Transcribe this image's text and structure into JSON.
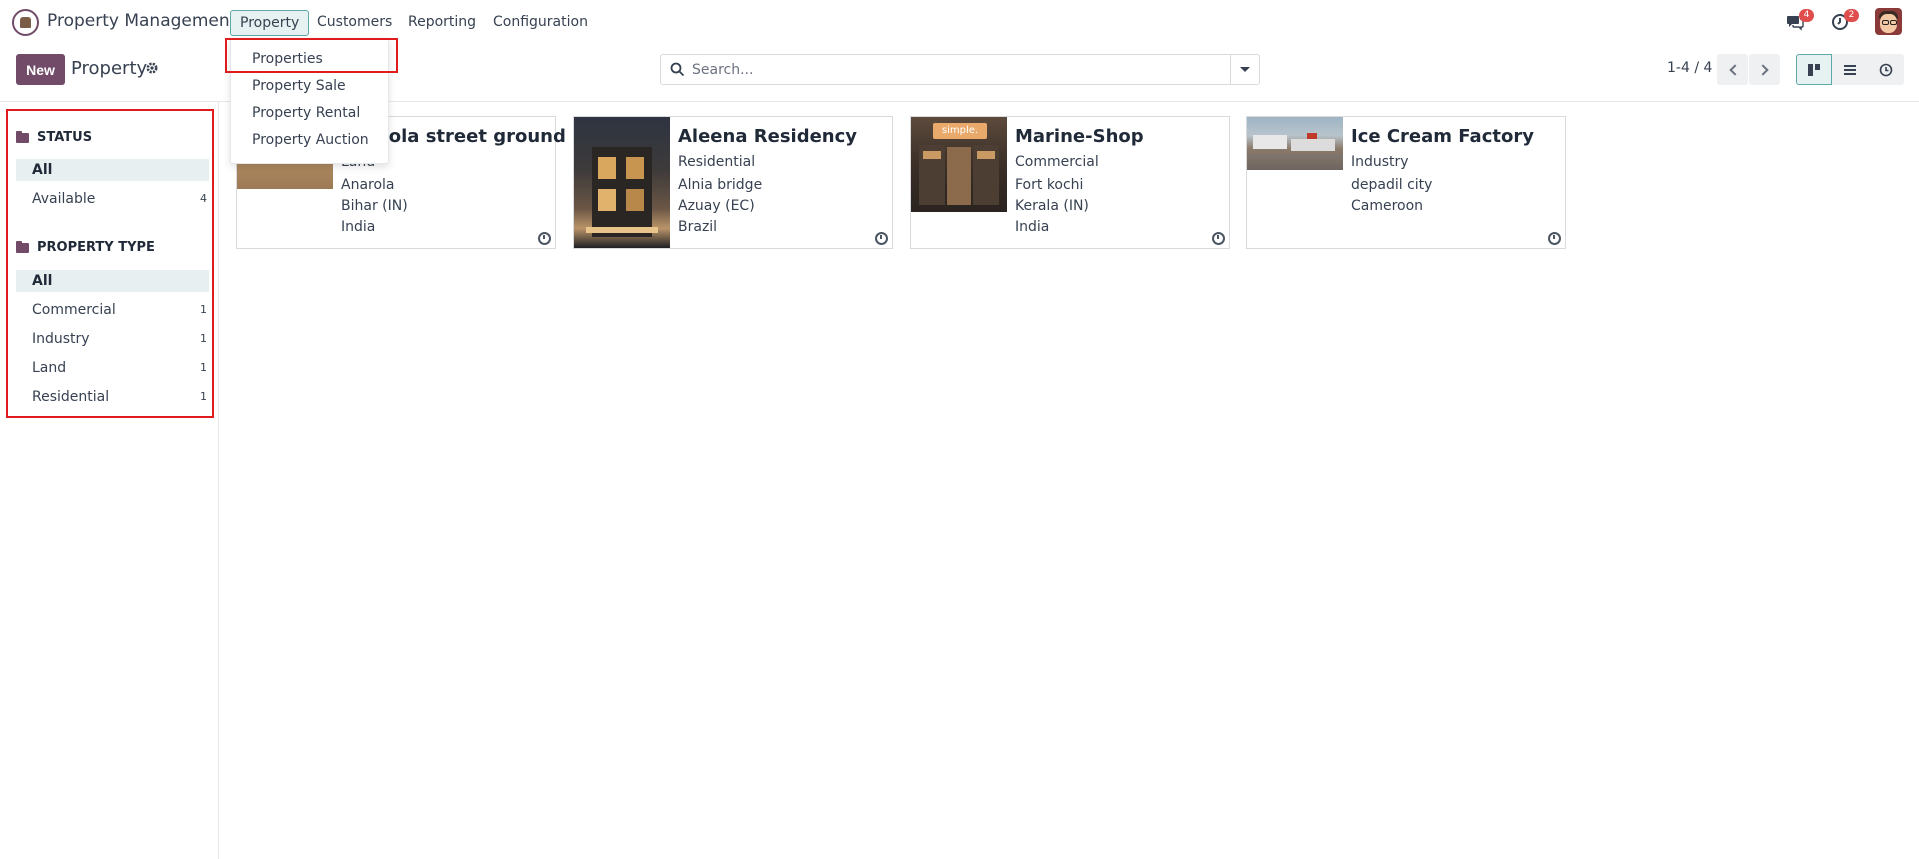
{
  "app": {
    "name": "Property Management"
  },
  "menu": {
    "property": "Property",
    "customers": "Customers",
    "reporting": "Reporting",
    "configuration": "Configuration"
  },
  "dropdown": [
    "Properties",
    "Property Sale",
    "Property Rental",
    "Property Auction"
  ],
  "systray": {
    "messages_count": "4",
    "activities_count": "2"
  },
  "control_panel": {
    "new_label": "New",
    "title": "Property",
    "search_placeholder": "Search...",
    "pager": "1-4 / 4"
  },
  "sidebar": {
    "status": {
      "title": "STATUS",
      "items": [
        {
          "label": "All",
          "count": ""
        },
        {
          "label": "Available",
          "count": "4"
        }
      ]
    },
    "property_type": {
      "title": "PROPERTY TYPE",
      "items": [
        {
          "label": "All",
          "count": ""
        },
        {
          "label": "Commercial",
          "count": "1"
        },
        {
          "label": "Industry",
          "count": "1"
        },
        {
          "label": "Land",
          "count": "1"
        },
        {
          "label": "Residential",
          "count": "1"
        }
      ]
    }
  },
  "cards": [
    {
      "title": "Anarola street ground",
      "type": "Land",
      "l1": "Anarola",
      "l2": "Bihar (IN)",
      "l3": "India"
    },
    {
      "title": "Aleena Residency",
      "type": "Residential",
      "l1": "Alnia bridge",
      "l2": "Azuay (EC)",
      "l3": "Brazil"
    },
    {
      "title": "Marine-Shop",
      "type": "Commercial",
      "l1": "Fort kochi",
      "l2": "Kerala (IN)",
      "l3": "India",
      "sign": "simple."
    },
    {
      "title": "Ice Cream Factory",
      "type": "Industry",
      "l1": "depadil city",
      "l2": "Cameroon",
      "l3": ""
    }
  ],
  "colors": {
    "brand": "#714B67",
    "accent": "#5fa8a8",
    "highlight": "#e01b1b"
  }
}
